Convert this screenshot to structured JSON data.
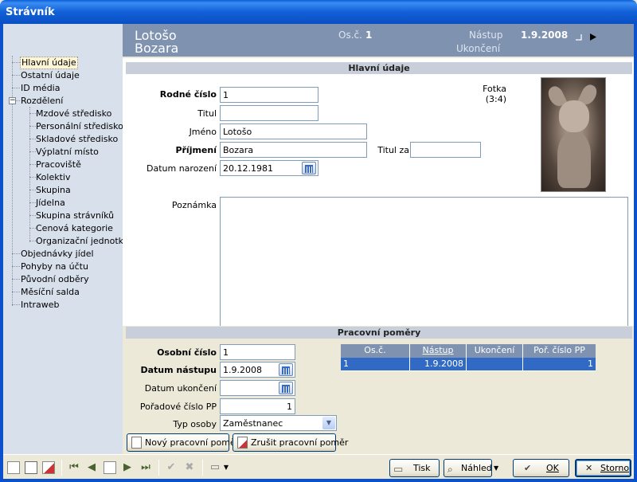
{
  "window": {
    "title": "Strávník"
  },
  "tree": {
    "items": [
      {
        "label": "Hlavní údaje"
      },
      {
        "label": "Ostatní údaje"
      },
      {
        "label": "ID média"
      },
      {
        "label": "Rozdělení"
      },
      {
        "label": "Mzdové středisko"
      },
      {
        "label": "Personální středisko"
      },
      {
        "label": "Skladové středisko"
      },
      {
        "label": "Výplatní místo"
      },
      {
        "label": "Pracoviště"
      },
      {
        "label": "Kolektiv"
      },
      {
        "label": "Skupina"
      },
      {
        "label": "Jídelna"
      },
      {
        "label": "Skupina strávníků"
      },
      {
        "label": "Cenová kategorie"
      },
      {
        "label": "Organizační jednotka"
      },
      {
        "label": "Objednávky jídel"
      },
      {
        "label": "Pohyby na účtu"
      },
      {
        "label": "Původní odběry"
      },
      {
        "label": "Měsíční salda"
      },
      {
        "label": "Intraweb"
      }
    ],
    "expander": "−"
  },
  "header": {
    "surname": "Lotošo",
    "firstname": "Bozara",
    "osc_label": "Os.č.",
    "osc_value": "1",
    "nastup_label": "Nástup",
    "nastup_value": "1.9.2008",
    "ukonceni_label": "Ukončení"
  },
  "main": {
    "section_title": "Hlavní údaje",
    "rodne_cislo_label": "Rodné číslo",
    "rodne_cislo_value": "1",
    "titul_label": "Titul",
    "titul_value": "",
    "jmeno_label": "Jméno",
    "jmeno_value": "Lotošo",
    "prijmeni_label": "Příjmení",
    "prijmeni_value": "Bozara",
    "titul_za_label": "Titul za",
    "titul_za_value": "",
    "datum_narozeni_label": "Datum narození",
    "datum_narozeni_value": "20.12.1981",
    "poznamka_label": "Poznámka",
    "fotka_label": "Fotka",
    "fotka_ratio": "(3:4)"
  },
  "pp": {
    "section_title": "Pracovní poměry",
    "osobni_cislo_label": "Osobní číslo",
    "osobni_cislo_value": "1",
    "datum_nastupu_label": "Datum nástupu",
    "datum_nastupu_value": "1.9.2008",
    "datum_ukonceni_label": "Datum ukončení",
    "datum_ukonceni_value": "",
    "poradove_label": "Pořadové číslo PP",
    "poradove_value": "1",
    "typ_osoby_label": "Typ osoby",
    "typ_osoby_value": "Zaměstnanec",
    "btn_novy": "Nový pracovní poměr",
    "btn_zrusit": "Zrušit pracovní poměr",
    "grid": {
      "columns": [
        "Os.č.",
        "Nástup",
        "Ukončení",
        "Poř. číslo PP"
      ],
      "rows": [
        [
          "1",
          "1.9.2008",
          "",
          "1"
        ]
      ]
    }
  },
  "toolbar": {
    "tisk": "Tisk",
    "nahled": "Náhled",
    "ok": "OK",
    "storno": "Storno"
  }
}
